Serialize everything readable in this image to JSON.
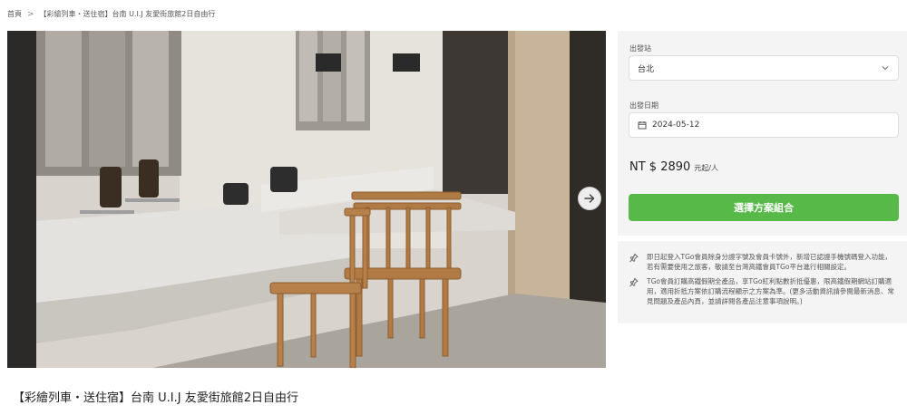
{
  "breadcrumb": {
    "home": "首頁",
    "separator": ">",
    "current": "【彩繪列車・送住宿】台南 U.I.J 友愛街旅館2日自由行"
  },
  "hero": {
    "carousel_dots": 12,
    "active_dot": 1,
    "next_icon": "arrow-right-icon"
  },
  "product": {
    "title": "【彩繪列車・送住宿】台南 U.I.J 友愛街旅館2日自由行"
  },
  "booking": {
    "departure_label": "出發站",
    "departure_value": "台北",
    "date_label": "出發日期",
    "date_value": "2024-05-12",
    "price": "NT $ 2890",
    "price_unit": "元起/人",
    "cta_label": "選擇方案組合",
    "cta_color": "#56b948"
  },
  "notes": [
    "即日起登入TGo會員除身分證字號及會員卡號外，新增已認證手機號碼登入功能，若有需要使用之旅客，敬請至台灣高鐵會員TGo平台進行相關設定。",
    "TGo會員訂購高鐵假期全產品，享TGo紅利點數折抵優惠，限高鐵假期網站訂購適用，適用折抵方案依訂購流程顯示之方案為準。(更多活動資訊請參閱最新消息、常見問題及產品內頁，並請詳閱各產品注意事項說明。)"
  ]
}
